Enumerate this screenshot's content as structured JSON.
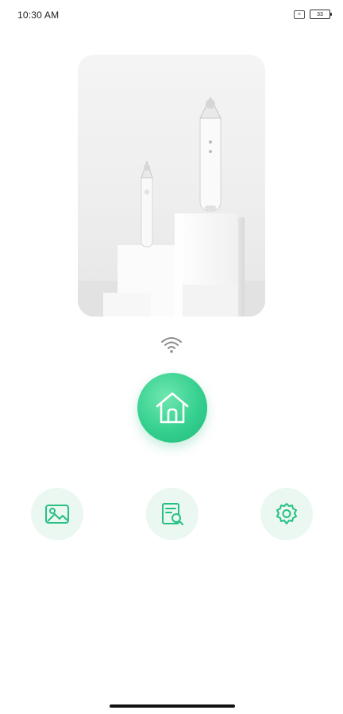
{
  "status_bar": {
    "time": "10:30 AM",
    "sim_icon": "sim-card-x-icon",
    "battery_level": "33"
  },
  "product_card": {
    "image": "product-photo-icon"
  },
  "connection": {
    "icon": "wifi-icon"
  },
  "main_action": {
    "icon": "home-icon",
    "color": "#35d08f"
  },
  "actions": [
    {
      "name": "gallery",
      "icon": "image-gallery-icon"
    },
    {
      "name": "report",
      "icon": "document-search-icon"
    },
    {
      "name": "settings",
      "icon": "gear-icon"
    }
  ],
  "theme": {
    "accent": "#35d08f",
    "accent_light": "#eaf8f1"
  }
}
